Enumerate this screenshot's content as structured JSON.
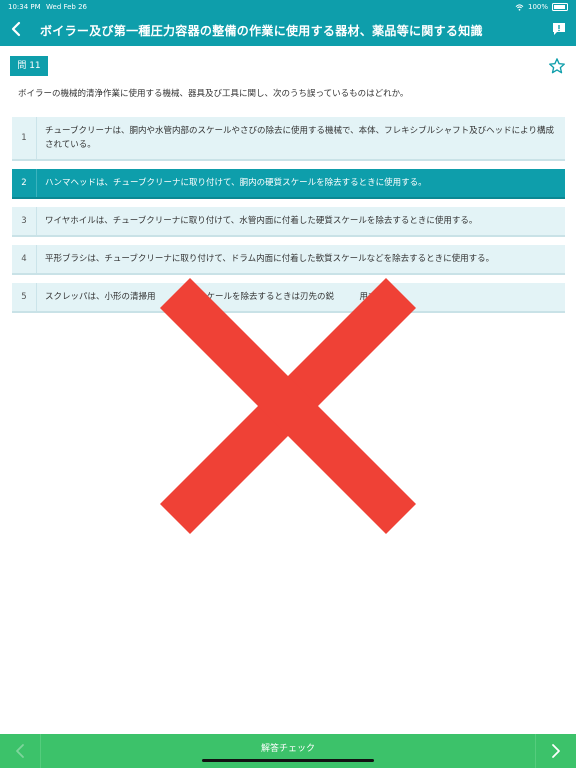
{
  "status_bar": {
    "time": "10:34 PM",
    "date": "Wed Feb 26",
    "battery": "100%"
  },
  "header": {
    "title": "ボイラー及び第一種圧力容器の整備の作業に使用する器材、薬品等に関する知識"
  },
  "question": {
    "badge": "問 11",
    "text": "ボイラーの機械的清浄作業に使用する機械、器具及び工具に関し、次のうち誤っているものはどれか。"
  },
  "options": [
    {
      "num": "1",
      "text": "チューブクリーナは、胴内や水管内部のスケールやさびの除去に使用する機械で、本体、フレキシブルシャフト及びヘッドにより構成されている。"
    },
    {
      "num": "2",
      "text": "ハンマヘッドは、チューブクリーナに取り付けて、胴内の硬質スケールを除去するときに使用する。"
    },
    {
      "num": "3",
      "text": "ワイヤホイルは、チューブクリーナに取り付けて、水管内面に付着した硬質スケールを除去するときに使用する。"
    },
    {
      "num": "4",
      "text": "平形ブラシは、チューブクリーナに取り付けて、ドラム内面に付着した軟質スケールなどを除去するときに使用する。"
    },
    {
      "num": "5",
      "text": "スクレッパは、小形の清掃用　　　硬質スケールを除去するときは刃先の鋭　　　用する。"
    }
  ],
  "selected_option": "2",
  "result": "incorrect",
  "footer": {
    "check_label": "解答チェック"
  },
  "colors": {
    "accent": "#0e9eab",
    "footer": "#3cc26a",
    "cross": "#ef4136"
  }
}
